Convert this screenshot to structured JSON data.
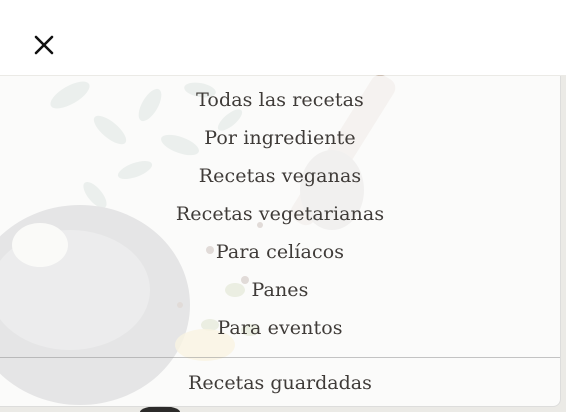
{
  "header": {
    "close_icon": "close-icon"
  },
  "menu": {
    "items": [
      {
        "label": "Todas las recetas"
      },
      {
        "label": "Por ingrediente"
      },
      {
        "label": "Recetas veganas"
      },
      {
        "label": "Recetas vegetarianas"
      },
      {
        "label": "Para celíacos"
      },
      {
        "label": "Panes"
      },
      {
        "label": "Para eventos"
      }
    ],
    "saved_label": "Recetas guardadas"
  },
  "colors": {
    "text": "#3f3b38",
    "panel": "#ffffff",
    "icon": "#111111"
  }
}
